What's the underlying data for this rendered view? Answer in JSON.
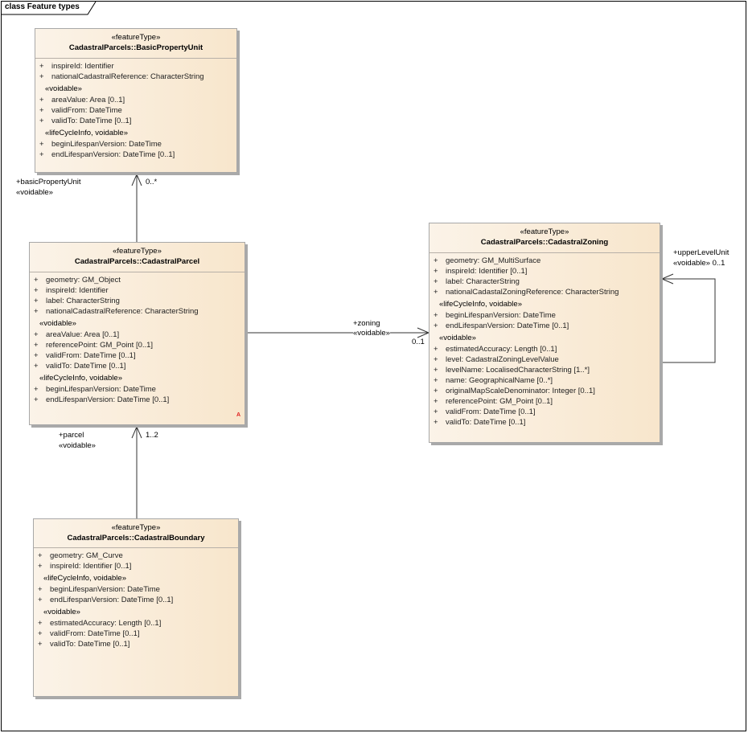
{
  "frame": {
    "title": "class Feature types"
  },
  "classes": {
    "bpu": {
      "stereotype": "«featureType»",
      "name": "CadastralParcels::BasicPropertyUnit",
      "attrs": [
        {
          "vis": "+",
          "text": "inspireId: Identifier"
        },
        {
          "vis": "+",
          "text": "nationalCadastralReference: CharacterString"
        }
      ],
      "groups": [
        {
          "label": "«voidable»",
          "attrs": [
            {
              "vis": "+",
              "text": "areaValue: Area [0..1]"
            },
            {
              "vis": "+",
              "text": "validFrom: DateTime"
            },
            {
              "vis": "+",
              "text": "validTo: DateTime [0..1]"
            }
          ]
        },
        {
          "label": "«lifeCycleInfo, voidable»",
          "attrs": [
            {
              "vis": "+",
              "text": "beginLifespanVersion: DateTime"
            },
            {
              "vis": "+",
              "text": "endLifespanVersion: DateTime [0..1]"
            }
          ]
        }
      ]
    },
    "parcel": {
      "stereotype": "«featureType»",
      "name": "CadastralParcels::CadastralParcel",
      "attrs": [
        {
          "vis": "+",
          "text": "geometry: GM_Object"
        },
        {
          "vis": "+",
          "text": "inspireId: Identifier"
        },
        {
          "vis": "+",
          "text": "label: CharacterString"
        },
        {
          "vis": "+",
          "text": "nationalCadastralReference: CharacterString"
        }
      ],
      "groups": [
        {
          "label": "«voidable»",
          "attrs": [
            {
              "vis": "+",
              "text": "areaValue: Area [0..1]"
            },
            {
              "vis": "+",
              "text": "referencePoint: GM_Point [0..1]"
            },
            {
              "vis": "+",
              "text": "validFrom: DateTime [0..1]"
            },
            {
              "vis": "+",
              "text": "validTo: DateTime [0..1]"
            }
          ]
        },
        {
          "label": "«lifeCycleInfo, voidable»",
          "attrs": [
            {
              "vis": "+",
              "text": "beginLifespanVersion: DateTime"
            },
            {
              "vis": "+",
              "text": "endLifespanVersion: DateTime [0..1]"
            }
          ]
        }
      ],
      "marker": "A"
    },
    "boundary": {
      "stereotype": "«featureType»",
      "name": "CadastralParcels::CadastralBoundary",
      "attrs": [
        {
          "vis": "+",
          "text": "geometry: GM_Curve"
        },
        {
          "vis": "+",
          "text": "inspireId: Identifier [0..1]"
        }
      ],
      "groups": [
        {
          "label": "«lifeCycleInfo, voidable»",
          "attrs": [
            {
              "vis": "+",
              "text": "beginLifespanVersion: DateTime"
            },
            {
              "vis": "+",
              "text": "endLifespanVersion: DateTime [0..1]"
            }
          ]
        },
        {
          "label": "«voidable»",
          "attrs": [
            {
              "vis": "+",
              "text": "estimatedAccuracy: Length [0..1]"
            },
            {
              "vis": "+",
              "text": "validFrom: DateTime [0..1]"
            },
            {
              "vis": "+",
              "text": "validTo: DateTime [0..1]"
            }
          ]
        }
      ]
    },
    "zoning": {
      "stereotype": "«featureType»",
      "name": "CadastralParcels::CadastralZoning",
      "attrs": [
        {
          "vis": "+",
          "text": "geometry: GM_MultiSurface"
        },
        {
          "vis": "+",
          "text": "inspireId: Identifier [0..1]"
        },
        {
          "vis": "+",
          "text": "label: CharacterString"
        },
        {
          "vis": "+",
          "text": "nationalCadastalZoningReference: CharacterString"
        }
      ],
      "groups": [
        {
          "label": "«lifeCycleInfo, voidable»",
          "attrs": [
            {
              "vis": "+",
              "text": "beginLifespanVersion: DateTime"
            },
            {
              "vis": "+",
              "text": "endLifespanVersion: DateTime [0..1]"
            }
          ]
        },
        {
          "label": "«voidable»",
          "attrs": [
            {
              "vis": "+",
              "text": "estimatedAccuracy: Length [0..1]"
            },
            {
              "vis": "+",
              "text": "level: CadastralZoningLevelValue"
            },
            {
              "vis": "+",
              "text": "levelName: LocalisedCharacterString [1..*]"
            },
            {
              "vis": "+",
              "text": "name: GeographicalName [0..*]"
            },
            {
              "vis": "+",
              "text": "originalMapScaleDenominator: Integer [0..1]"
            },
            {
              "vis": "+",
              "text": "referencePoint: GM_Point [0..1]"
            },
            {
              "vis": "+",
              "text": "validFrom: DateTime [0..1]"
            },
            {
              "vis": "+",
              "text": "validTo: DateTime [0..1]"
            }
          ]
        }
      ]
    }
  },
  "associations": {
    "bpu": {
      "role": "+basicPropertyUnit",
      "stereotype": "«voidable»",
      "multiplicity": "0..*"
    },
    "parcel": {
      "role": "+parcel",
      "stereotype": "«voidable»",
      "multiplicity": "1..2"
    },
    "zoning": {
      "role": "+zoning",
      "stereotype": "«voidable»",
      "multiplicity": "0..1"
    },
    "upper": {
      "role": "+upperLevelUnit",
      "stereotype_mult": "«voidable» 0..1"
    }
  }
}
